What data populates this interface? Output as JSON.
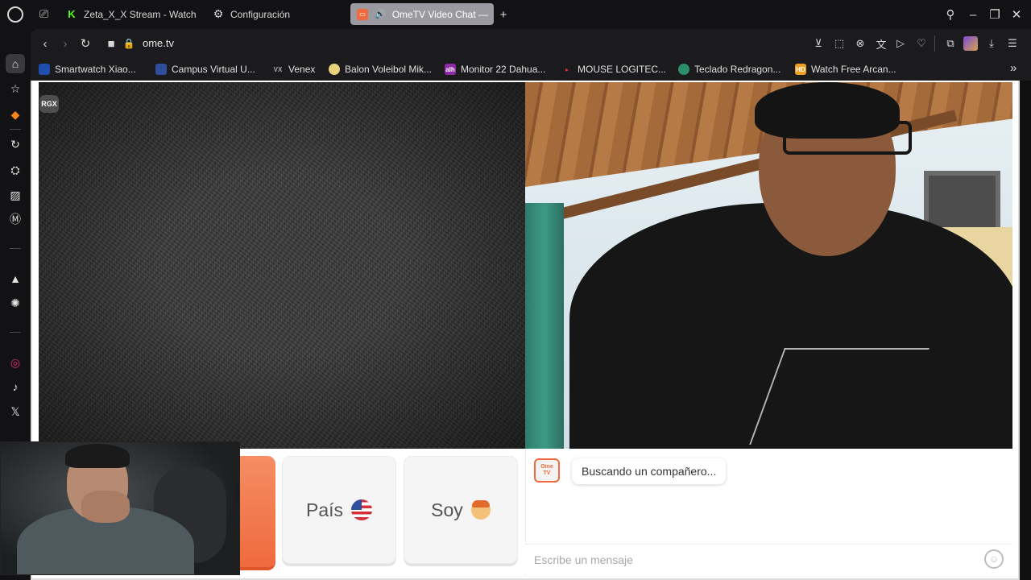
{
  "browser": {
    "tabs": [
      {
        "label": "Zeta_X_X Stream - Watch",
        "icon": "kick-icon",
        "color": "#53fc18"
      },
      {
        "label": "Configuración",
        "icon": "gear-icon"
      },
      {
        "label": "OmeTV Video Chat —",
        "icon": "ometv-favicon",
        "active": true
      }
    ],
    "url": "ome.tv",
    "bookmarks": [
      {
        "label": "Smartwatch Xiao...",
        "icon_text": ""
      },
      {
        "label": "Campus Virtual U...",
        "icon_text": ""
      },
      {
        "label": "Venex",
        "icon_text": "VX"
      },
      {
        "label": "Balon Voleibol Mik...",
        "icon_text": ""
      },
      {
        "label": "Monitor 22 Dahua...",
        "icon_text": "alh"
      },
      {
        "label": "MOUSE LOGITEC...",
        "icon_text": ""
      },
      {
        "label": "Teclado Redragon...",
        "icon_text": ""
      },
      {
        "label": "Watch Free Arcan...",
        "icon_text": "HD"
      }
    ]
  },
  "video": {
    "partner_badge": "RGX"
  },
  "filters": {
    "country_label": "País",
    "gender_label": "Soy"
  },
  "chat": {
    "logo_line1": "Ome",
    "logo_line2": "TV",
    "status_message": "Buscando un compañero...",
    "input_placeholder": "Escribe un mensaje",
    "input_value": ""
  },
  "colors": {
    "accent": "#f06a3e",
    "browser_bg": "#121214"
  }
}
